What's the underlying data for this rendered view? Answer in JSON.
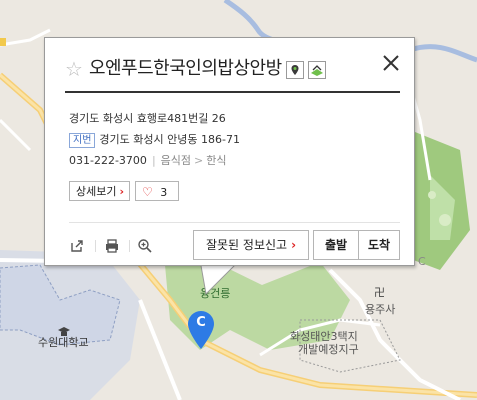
{
  "map": {
    "labels": {
      "university": "수원대학교",
      "royal_tomb": "융건릉",
      "temple_mark": "卍",
      "temple": "용주사",
      "district": [
        "화성태안3택지",
        "개발예정지구"
      ],
      "edge_letter": "C"
    },
    "marker": {
      "letter": "C",
      "color": "#2d7be5"
    }
  },
  "popup": {
    "title": "오엔푸드한국인의밥상안방",
    "favorite_icon": "star-icon",
    "close_icon": "close-icon",
    "address": "경기도 화성시 효행로481번길 26",
    "jibun_badge": "지번",
    "jibun_address": "경기도 화성시 안녕동 186-71",
    "phone": "031-222-3700",
    "category": "음식점",
    "subcategory": "한식",
    "detail_button": "상세보기",
    "like_count": "3",
    "report_button": "잘못된 정보신고",
    "start_button": "출발",
    "arrive_button": "도착"
  },
  "colors": {
    "accent_red": "#d22222",
    "green_area": "#a9d08e",
    "road": "#f7d27a"
  }
}
